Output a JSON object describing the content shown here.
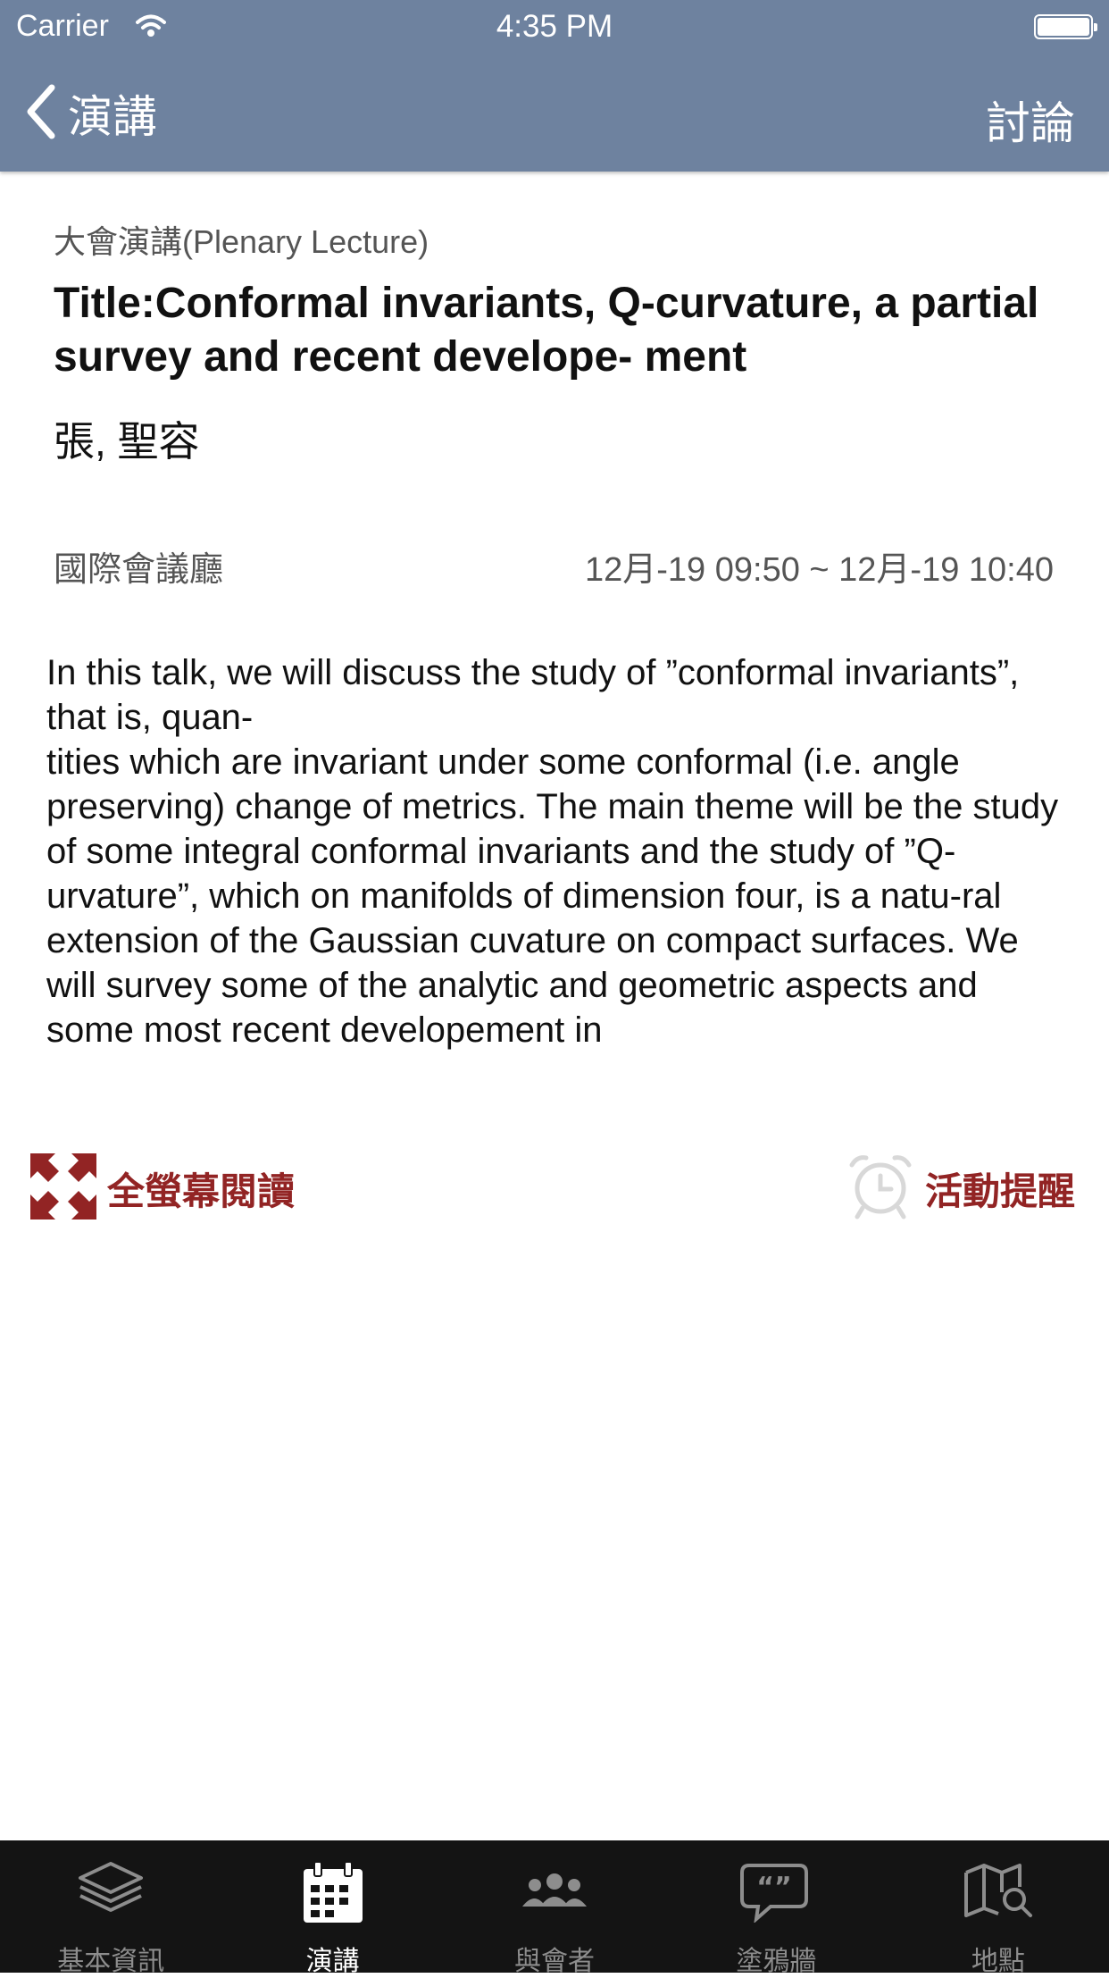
{
  "status_bar": {
    "carrier": "Carrier",
    "time": "4:35 PM"
  },
  "nav": {
    "back_label": "演講",
    "right_label": "討論"
  },
  "lecture": {
    "category": "大會演講(Plenary Lecture)",
    "title": "Title:Conformal invariants, Q-curvature, a partial survey and recent develope- ment",
    "speaker": "張, 聖容",
    "venue": "國際會議廳",
    "time_range": "12月-19 09:50 ~ 12月-19 10:40",
    "abstract": "In this talk, we will discuss the study of ”conformal invariants”, that is, quan-\ntities which are invariant under some conformal (i.e. angle preserving) change of metrics. The main theme will be the study of some integral conformal invariants and the study of ”Q-urvature”, which on manifolds of dimension four, is a natu-ral extension of the Gaussian cuvature on compact surfaces. We will survey some of the analytic and geometric aspects and some most recent developement in"
  },
  "actions": {
    "fullscreen_label": "全螢幕閱讀",
    "reminder_label": "活動提醒"
  },
  "tabs": [
    {
      "label": "基本資訊",
      "icon": "layers-icon"
    },
    {
      "label": "演講",
      "icon": "calendar-icon",
      "active": true
    },
    {
      "label": "與會者",
      "icon": "people-icon"
    },
    {
      "label": "塗鴉牆",
      "icon": "chat-bubble-icon"
    },
    {
      "label": "地點",
      "icon": "map-search-icon"
    }
  ],
  "colors": {
    "header": "#6e829f",
    "accent": "#922424",
    "tabbar": "#141414"
  }
}
